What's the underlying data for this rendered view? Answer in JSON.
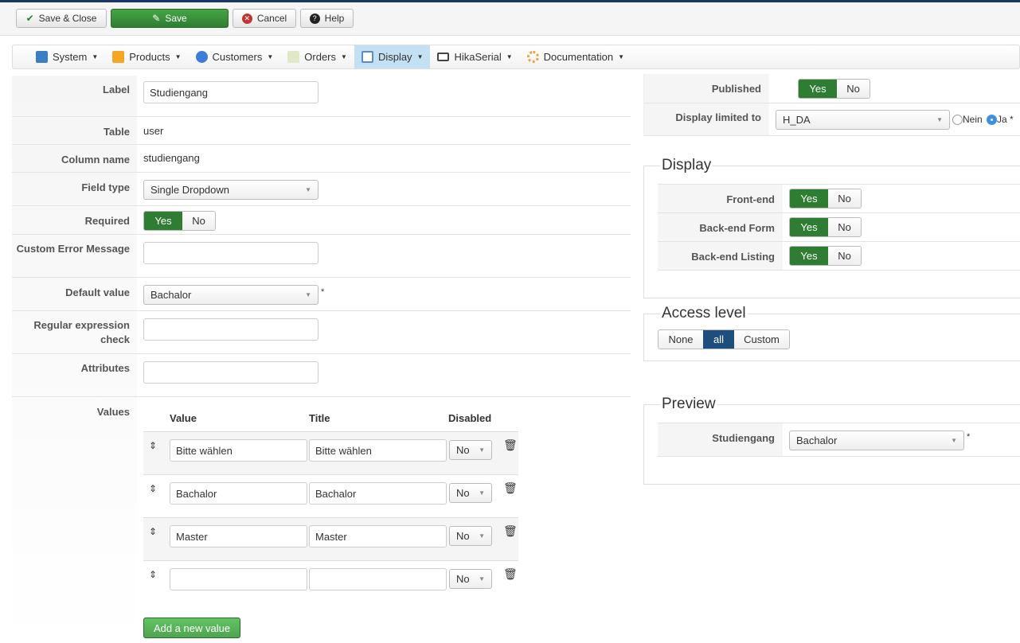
{
  "toolbar": {
    "save_close": "Save & Close",
    "save": "Save",
    "cancel": "Cancel",
    "help": "Help"
  },
  "menu": [
    {
      "label": "System",
      "color": "#3a7fc4"
    },
    {
      "label": "Products",
      "color": "#f5a623"
    },
    {
      "label": "Customers",
      "color": "#3b7dd8"
    },
    {
      "label": "Orders",
      "color": "#9cbf5a"
    },
    {
      "label": "Display",
      "color": "#5b8bc9"
    },
    {
      "label": "HikaSerial",
      "color": "#444444"
    },
    {
      "label": "Documentation",
      "color": "#f0a030"
    }
  ],
  "form": {
    "label_label": "Label",
    "label_value": "Studiengang",
    "table_label": "Table",
    "table_value": "user",
    "column_label": "Column name",
    "column_value": "studiengang",
    "fieldtype_label": "Field type",
    "fieldtype_value": "Single Dropdown",
    "required_label": "Required",
    "yes": "Yes",
    "no": "No",
    "custom_error_label": "Custom Error Message",
    "default_label": "Default value",
    "default_value": "Bachalor",
    "asterisk": "*",
    "regex_label": "Regular expression check",
    "attributes_label": "Attributes",
    "values_label": "Values",
    "values_headers": {
      "value": "Value",
      "title": "Title",
      "disabled": "Disabled"
    },
    "values": [
      {
        "value": "Bitte wählen",
        "title": "Bitte wählen",
        "disabled": "No"
      },
      {
        "value": "Bachalor",
        "title": "Bachalor",
        "disabled": "No"
      },
      {
        "value": "Master",
        "title": "Master",
        "disabled": "No"
      },
      {
        "value": "",
        "title": "",
        "disabled": "No"
      }
    ],
    "add_value": "Add a new value"
  },
  "right": {
    "published_label": "Published",
    "display_limited_label": "Display limited to",
    "display_limited_value": "H_DA",
    "nein": "Nein",
    "ja": "Ja *",
    "display_legend": "Display",
    "frontend": "Front-end",
    "backend_form": "Back-end Form",
    "backend_listing": "Back-end Listing",
    "access_legend": "Access level",
    "access_none": "None",
    "access_all": "all",
    "access_custom": "Custom",
    "preview_legend": "Preview",
    "preview_label": "Studiengang",
    "preview_value": "Bachalor"
  }
}
